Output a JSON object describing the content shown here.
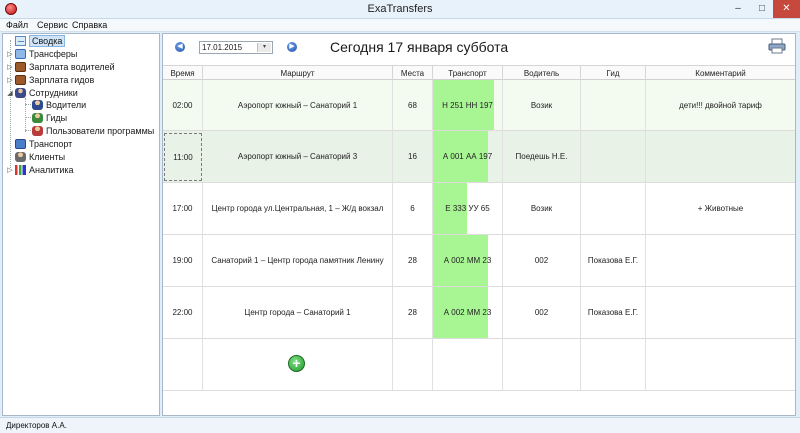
{
  "window": {
    "title": "ExaTransfers",
    "min_glyph": "–",
    "max_glyph": "□",
    "close_glyph": "✕"
  },
  "menu": [
    "Файл",
    "Сервис",
    "Справка"
  ],
  "sidebar": {
    "items": [
      {
        "label": "Сводка",
        "icon": "summary-icon",
        "selected": true
      },
      {
        "label": "Трансферы",
        "icon": "transfer-icon"
      },
      {
        "label": "Зарплата водителей",
        "icon": "wallet-icon"
      },
      {
        "label": "Зарплата гидов",
        "icon": "wallet-icon"
      },
      {
        "label": "Сотрудники",
        "icon": "people-icon"
      },
      {
        "label": "Водители",
        "icon": "driver-icon"
      },
      {
        "label": "Гиды",
        "icon": "guide-icon"
      },
      {
        "label": "Пользователи программы",
        "icon": "user-icon"
      },
      {
        "label": "Транспорт",
        "icon": "bus-icon"
      },
      {
        "label": "Клиенты",
        "icon": "client-icon"
      },
      {
        "label": "Аналитика",
        "icon": "chart-icon"
      }
    ]
  },
  "toolbar": {
    "prev_glyph": "◀",
    "next_glyph": "▶",
    "date_value": "17.01.2015",
    "date_drop_glyph": "▾",
    "headline": "Сегодня   17 января   суббота"
  },
  "table": {
    "headers": [
      "Время",
      "Маршрут",
      "Места",
      "Транспорт",
      "Водитель",
      "Гид",
      "Комментарий"
    ],
    "rows": [
      {
        "time": "02:00",
        "route": "Аэропорт южный  –  Санаторий 1",
        "seats": "68",
        "transport": "Н 251 НН 197",
        "fill": 0.88,
        "driver": "Возик",
        "guide": "",
        "comment": "дети!!!  двойной тариф"
      },
      {
        "time": "11:00",
        "route": "Аэропорт южный  –  Санаторий 3",
        "seats": "16",
        "transport": "А 001 АА 197",
        "fill": 0.8,
        "driver": "Поедешь Н.Е.",
        "guide": "",
        "comment": ""
      },
      {
        "time": "17:00",
        "route": "Центр города ул.Центральная, 1  –  Ж/д вокзал",
        "seats": "6",
        "transport": "Е 333 УУ 65",
        "fill": 0.49,
        "driver": "Возик",
        "guide": "",
        "comment": "+ Животные"
      },
      {
        "time": "19:00",
        "route": "Санаторий 1  –  Центр города памятник Ленину",
        "seats": "28",
        "transport": "А 002 ММ 23",
        "fill": 0.8,
        "driver": "002",
        "guide": "Показова Е.Г.",
        "comment": ""
      },
      {
        "time": "22:00",
        "route": "Центр города  –  Санаторий 1",
        "seats": "28",
        "transport": "А 002 ММ 23",
        "fill": 0.8,
        "driver": "002",
        "guide": "Показова Е.Г.",
        "comment": ""
      }
    ],
    "add_glyph": "+"
  },
  "status": {
    "user": "Директоров А.А."
  }
}
